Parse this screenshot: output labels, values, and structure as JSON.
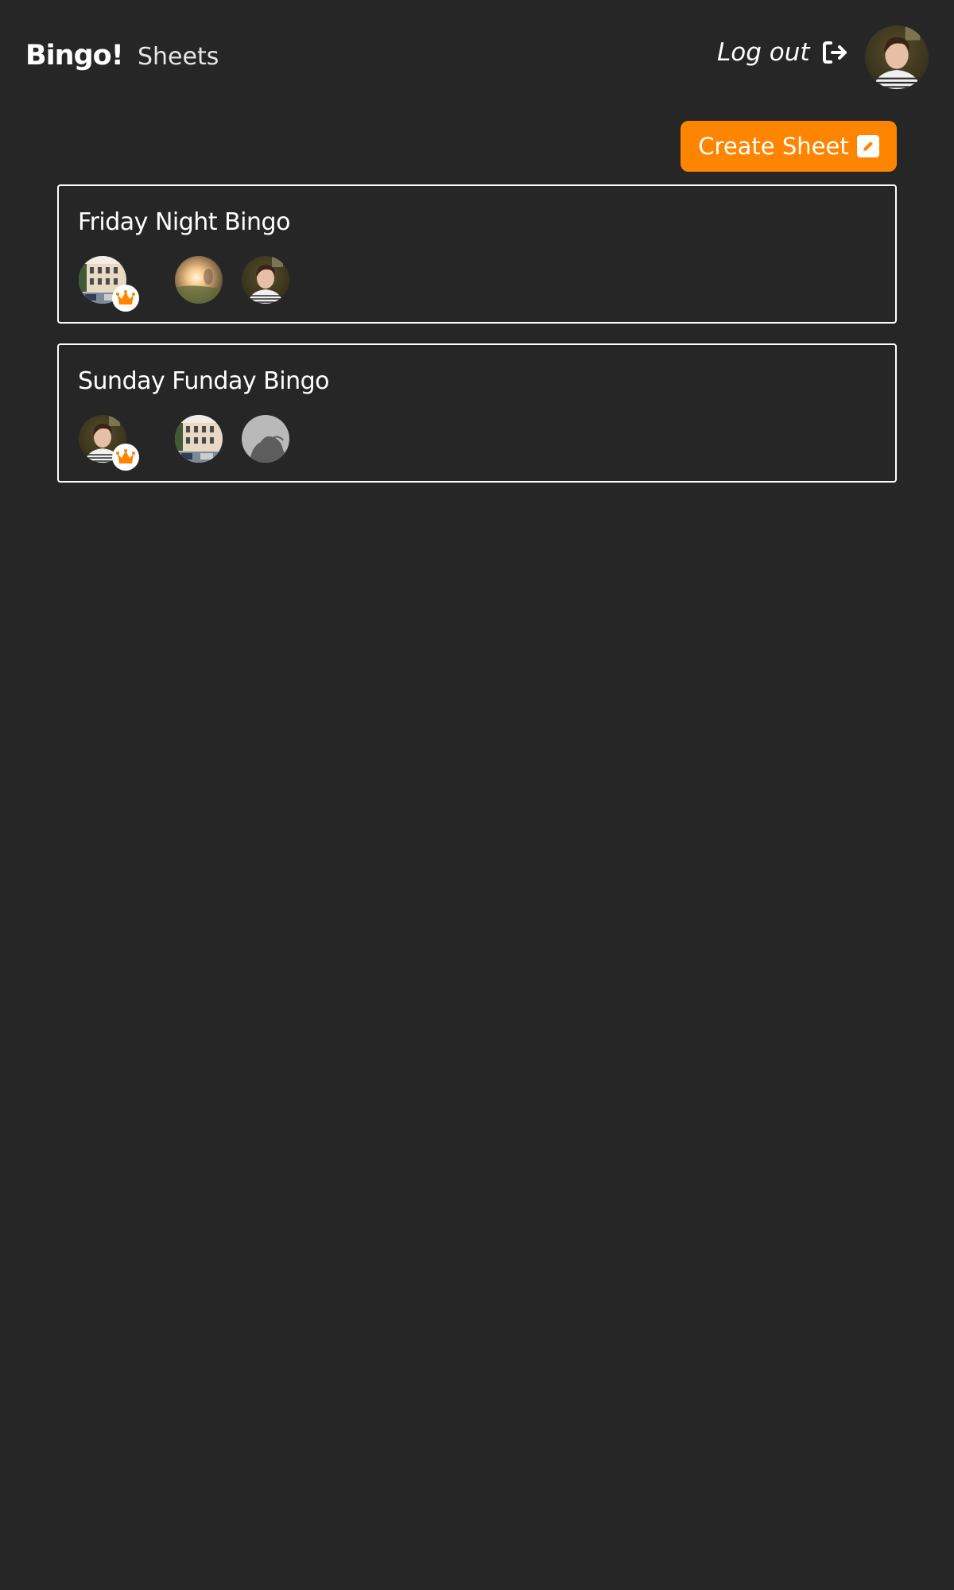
{
  "navbar": {
    "brand": "Bingo!",
    "links": [
      {
        "label": "Sheets"
      }
    ],
    "logout_label": "Log out",
    "logout_icon": "sign-out-icon",
    "profile_avatar": "user-photo-young-man-striped-shirt"
  },
  "toolbar": {
    "create_label": "Create Sheet",
    "create_icon": "pencil-square-icon"
  },
  "colors": {
    "background": "#262626",
    "accent": "#ff8400",
    "text": "#ffffff",
    "card_border": "#ffffff"
  },
  "sheets": [
    {
      "title": "Friday Night Bingo",
      "members": [
        {
          "avatar": "building-photo",
          "owner": true
        },
        {
          "avatar": "sunset-field-photo",
          "owner": false
        },
        {
          "avatar": "young-man-striped-shirt-photo",
          "owner": false
        }
      ]
    },
    {
      "title": "Sunday Funday Bingo",
      "members": [
        {
          "avatar": "young-man-striped-shirt-photo",
          "owner": true
        },
        {
          "avatar": "building-photo",
          "owner": false
        },
        {
          "avatar": "default-silhouette",
          "owner": false
        }
      ]
    }
  ]
}
